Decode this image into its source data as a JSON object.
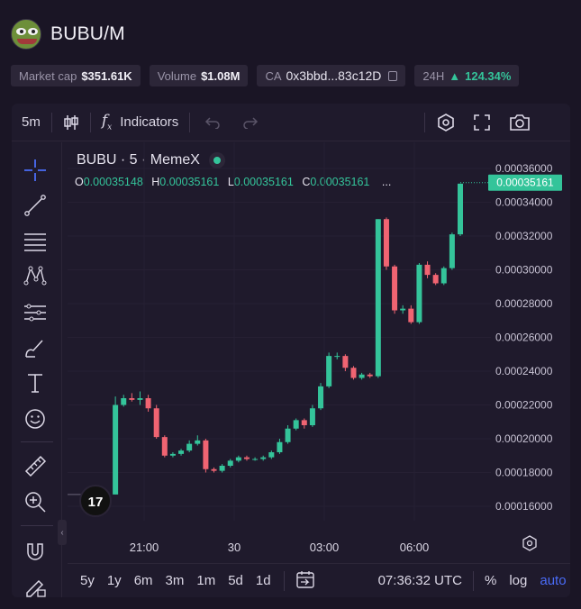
{
  "token": {
    "title": "BUBU/M"
  },
  "stats": {
    "market_cap_label": "Market cap",
    "market_cap_value": "$351.61K",
    "volume_label": "Volume",
    "volume_value": "$1.08M",
    "ca_label": "CA",
    "ca_value": "0x3bbd...83c12D",
    "change_period": "24H",
    "change_value": "124.34%"
  },
  "toolbar": {
    "interval": "5m",
    "indicators_label": "Indicators"
  },
  "legend": {
    "symbol": "BUBU · 5 · MemeX",
    "o_label": "O",
    "o_value": "0.00035148",
    "h_label": "H",
    "h_value": "0.00035161",
    "l_label": "L",
    "l_value": "0.00035161",
    "c_label": "C",
    "c_value": "0.00035161",
    "more": "..."
  },
  "bottom": {
    "ranges": [
      "5y",
      "1y",
      "6m",
      "3m",
      "1m",
      "5d",
      "1d"
    ],
    "time": "07:36:32 UTC",
    "percent_label": "%",
    "log_label": "log",
    "auto_label": "auto"
  },
  "colors": {
    "up": "#34c49a",
    "down": "#f06472",
    "accent": "#4a6cf7"
  },
  "chart_data": {
    "type": "candlestick",
    "y_ticks": [
      "0.00036000",
      "0.00034000",
      "0.00032000",
      "0.00030000",
      "0.00028000",
      "0.00026000",
      "0.00024000",
      "0.00022000",
      "0.00020000",
      "0.00018000",
      "0.00016000"
    ],
    "x_ticks": [
      "21:00",
      "30",
      "03:00",
      "06:00"
    ],
    "last_price": "0.00035161",
    "ylim": [
      0.00015,
      0.00036
    ],
    "candles": [
      [
        0.000167,
        0.000167,
        0.000167,
        0.000167
      ],
      [
        0.000167,
        0.000225,
        0.000167,
        0.00022
      ],
      [
        0.00022,
        0.000226,
        0.000219,
        0.000224
      ],
      [
        0.000224,
        0.000227,
        0.000222,
        0.000223
      ],
      [
        0.000223,
        0.000228,
        0.00022,
        0.000224
      ],
      [
        0.000224,
        0.000226,
        0.000216,
        0.000218
      ],
      [
        0.000218,
        0.00022,
        0.0002,
        0.000201
      ],
      [
        0.000201,
        0.000202,
        0.000189,
        0.00019
      ],
      [
        0.00019,
        0.000192,
        0.000189,
        0.000191
      ],
      [
        0.000191,
        0.000194,
        0.00019,
        0.000193
      ],
      [
        0.000193,
        0.000199,
        0.000192,
        0.000197
      ],
      [
        0.000197,
        0.000202,
        0.000196,
        0.000199
      ],
      [
        0.000199,
        0.0002,
        0.00018,
        0.000182
      ],
      [
        0.000182,
        0.000183,
        0.00018,
        0.000181
      ],
      [
        0.000181,
        0.000185,
        0.00018,
        0.000184
      ],
      [
        0.000184,
        0.000188,
        0.000183,
        0.000187
      ],
      [
        0.000187,
        0.00019,
        0.000186,
        0.000189
      ],
      [
        0.000189,
        0.00019,
        0.000187,
        0.000188
      ],
      [
        0.000188,
        0.000189,
        0.000187,
        0.000188
      ],
      [
        0.000188,
        0.00019,
        0.000187,
        0.000189
      ],
      [
        0.000189,
        0.000193,
        0.000188,
        0.000192
      ],
      [
        0.000192,
        0.0002,
        0.000191,
        0.000198
      ],
      [
        0.000198,
        0.000208,
        0.000197,
        0.000206
      ],
      [
        0.000206,
        0.000212,
        0.000205,
        0.000211
      ],
      [
        0.000211,
        0.000212,
        0.000206,
        0.000208
      ],
      [
        0.000208,
        0.00022,
        0.000207,
        0.000218
      ],
      [
        0.000218,
        0.000233,
        0.000217,
        0.000231
      ],
      [
        0.000231,
        0.000251,
        0.00023,
        0.000249
      ],
      [
        0.000249,
        0.000251,
        0.000247,
        0.000249
      ],
      [
        0.000249,
        0.00025,
        0.00024,
        0.000242
      ],
      [
        0.000242,
        0.000243,
        0.000235,
        0.000236
      ],
      [
        0.000236,
        0.000239,
        0.000235,
        0.000238
      ],
      [
        0.000238,
        0.000239,
        0.000236,
        0.000237
      ],
      [
        0.000237,
        0.00033,
        0.000236,
        0.00033
      ],
      [
        0.00033,
        0.000331,
        0.0003,
        0.000302
      ],
      [
        0.000302,
        0.000303,
        0.000274,
        0.000276
      ],
      [
        0.000276,
        0.000279,
        0.000274,
        0.000277
      ],
      [
        0.000277,
        0.000279,
        0.000268,
        0.000269
      ],
      [
        0.000269,
        0.000304,
        0.000268,
        0.000303
      ],
      [
        0.000303,
        0.000305,
        0.000295,
        0.000297
      ],
      [
        0.000297,
        0.000298,
        0.000291,
        0.000292
      ],
      [
        0.000292,
        0.000302,
        0.000291,
        0.000301
      ],
      [
        0.000301,
        0.000322,
        0.0003,
        0.000321
      ],
      [
        0.000321,
        0.000351,
        0.00032,
        0.000351
      ]
    ]
  }
}
